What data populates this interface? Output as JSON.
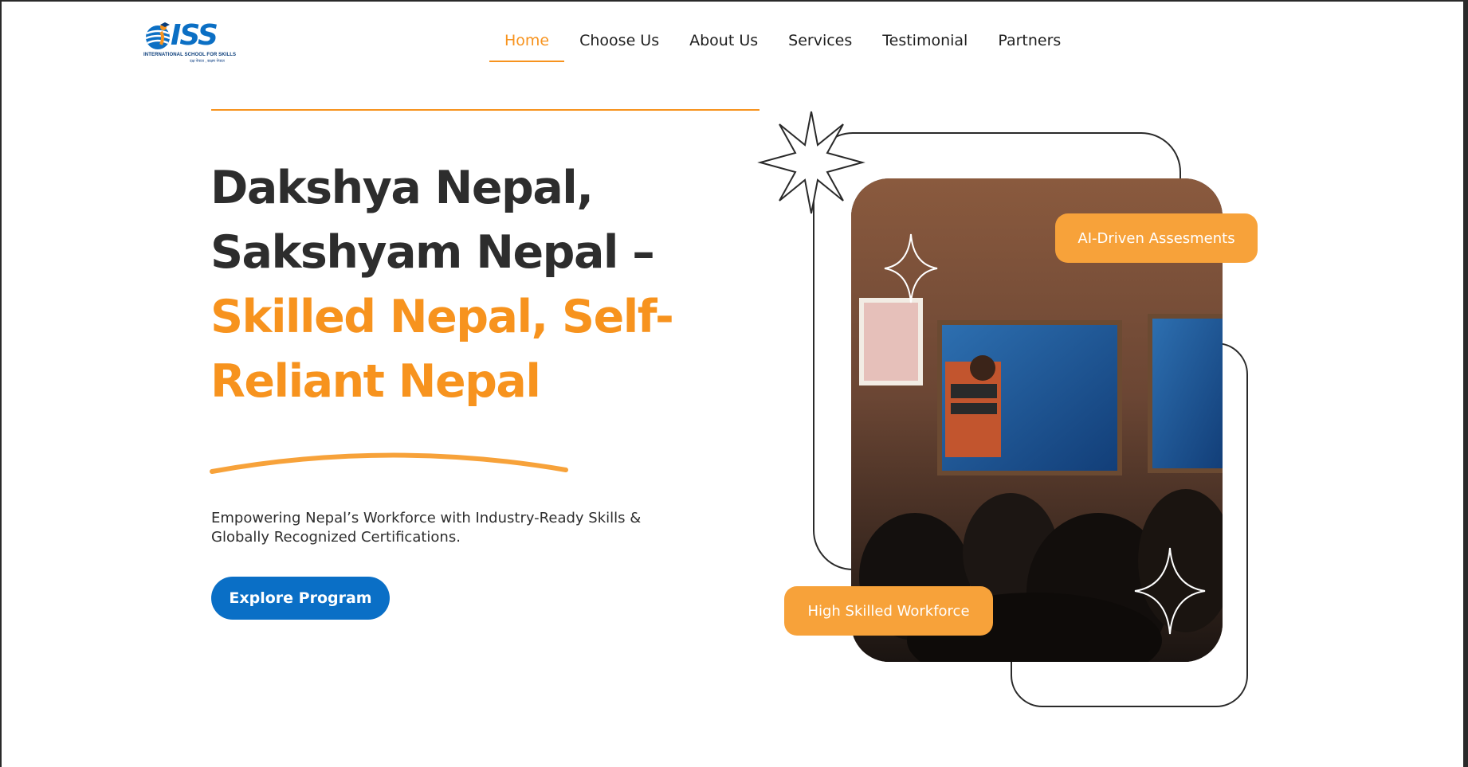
{
  "brand": {
    "logo_letters": "ISS",
    "tagline": "INTERNATIONAL SCHOOL FOR SKILLS",
    "subtagline": "दक्ष नेपाल , सक्षम नेपाल"
  },
  "nav": {
    "items": [
      {
        "label": "Home",
        "active": true
      },
      {
        "label": "Choose Us",
        "active": false
      },
      {
        "label": "About Us",
        "active": false
      },
      {
        "label": "Services",
        "active": false
      },
      {
        "label": "Testimonial",
        "active": false
      },
      {
        "label": "Partners",
        "active": false
      }
    ]
  },
  "hero": {
    "headline_line1": "Dakshya Nepal,",
    "headline_line2": "Sakshyam Nepal –",
    "headline_line3": "Skilled Nepal, Self-",
    "headline_line4": "Reliant Nepal",
    "subtitle_line1": "Empowering Nepal’s Workforce with Industry-Ready Skills &",
    "subtitle_line2": "Globally Recognized Certifications.",
    "cta_label": "Explore Program",
    "badge_ai": "AI-Driven Assesments",
    "badge_workforce": "High Skilled Workforce",
    "photo_icon": "classroom-photo"
  },
  "colors": {
    "accent": "#f7931e",
    "badge": "#f7a23a",
    "primary_button": "#0a6fc6",
    "heading": "#2d2d2d"
  }
}
